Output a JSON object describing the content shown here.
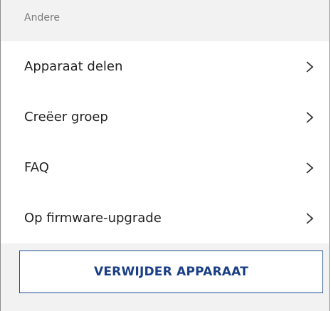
{
  "section": {
    "title": "Andere"
  },
  "items": [
    {
      "label": "Apparaat delen"
    },
    {
      "label": "Creëer groep"
    },
    {
      "label": "FAQ"
    },
    {
      "label": "Op firmware-upgrade"
    }
  ],
  "actions": {
    "delete_label": "VERWIJDER APPARAAT"
  },
  "icons": {
    "row_chevron": "chevron-right-icon"
  },
  "colors": {
    "background": "#f2f2f2",
    "delete_accent": "#1a3f85"
  }
}
